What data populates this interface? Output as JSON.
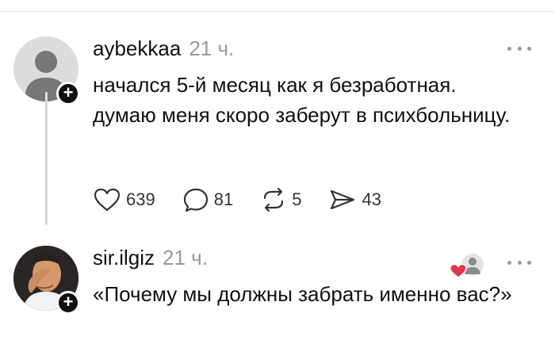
{
  "posts": [
    {
      "username": "aybekkaa",
      "timestamp": "21 ч.",
      "text": "начался 5-й месяц как я безработная. думаю меня скоро заберут в психбольницу.",
      "stats": {
        "likes": "639",
        "replies": "81",
        "reposts": "5",
        "shares": "43"
      },
      "avatar_icon": "default-person-icon"
    },
    {
      "username": "sir.ilgiz",
      "timestamp": "21 ч.",
      "text": "«Почему мы должны забрать именно вас?»",
      "avatar_icon": "memoji-facepalm-avatar"
    }
  ],
  "colors": {
    "text": "#111111",
    "muted": "#9a9a9a",
    "heart": "#e8344a",
    "avatar_default": "#dcdcdc"
  }
}
